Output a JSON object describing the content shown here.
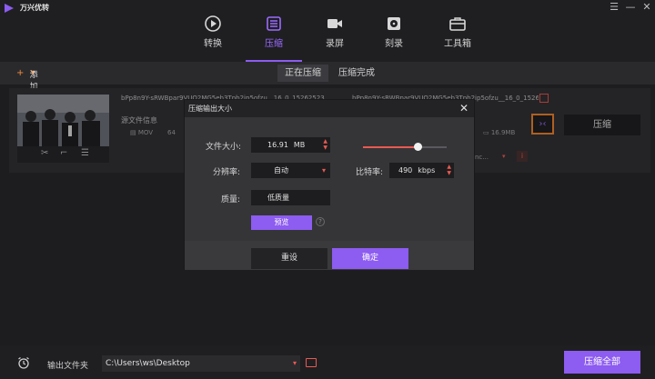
{
  "app": {
    "title": "万兴优转"
  },
  "nav": [
    {
      "label": "转换",
      "icon": "convert-icon"
    },
    {
      "label": "压缩",
      "icon": "compress-icon"
    },
    {
      "label": "录屏",
      "icon": "record-icon"
    },
    {
      "label": "刻录",
      "icon": "burn-disc-icon"
    },
    {
      "label": "工具箱",
      "icon": "toolbox-icon"
    }
  ],
  "toolbar": {
    "add_file": "添加文件",
    "tab_compressing": "正在压缩",
    "tab_done": "压缩完成"
  },
  "file": {
    "source_name": "bPp8n9Y-sRWBpar9VUO2MG5eb3Tpb2ip5ofzu__16_0_15262523",
    "target_name": "bPp8n9Y-sRWBpar9VUO2MG5eb3Tpb2ip5ofzu__16_0_15262",
    "source_info_label": "源文件信息",
    "source_format": "MOV",
    "source_res_partial": "64",
    "target_size": "16.9MB",
    "target_codec_partial": "nc...",
    "compress_label": "压缩"
  },
  "dialog": {
    "title": "压缩输出大小",
    "file_size_label": "文件大小:",
    "file_size_value": "16.91",
    "file_size_unit": "MB",
    "resolution_label": "分辨率:",
    "resolution_value": "自动",
    "bitrate_label": "比特率:",
    "bitrate_value": "490",
    "bitrate_unit": "kbps",
    "quality_label": "质量:",
    "quality_value": "低质量",
    "preview_label": "预览",
    "help_glyph": "?",
    "reset_label": "重设",
    "ok_label": "确定",
    "slider_fraction": 0.65
  },
  "bottom": {
    "output_label": "输出文件夹",
    "output_path": "C:\\Users\\ws\\Desktop",
    "compress_all": "压缩全部"
  },
  "colors": {
    "accent": "#8d5cf0",
    "orange": "#e8802c",
    "red": "#e85a52"
  }
}
